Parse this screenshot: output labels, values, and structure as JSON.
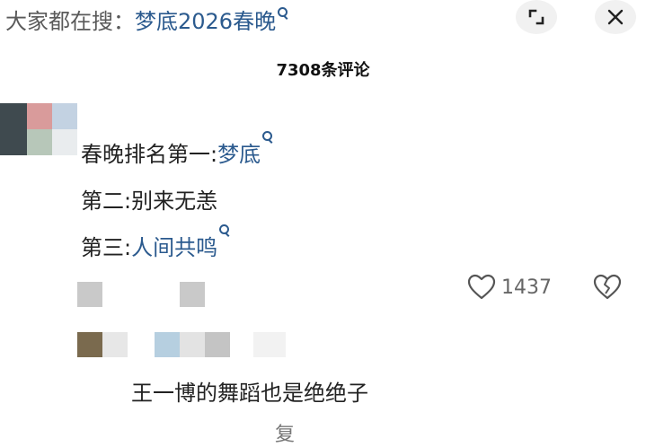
{
  "top_bar": {
    "prefix": "大家都在搜：",
    "search_term": "梦底2026春晚"
  },
  "header": {
    "comment_count": "7308条评论"
  },
  "comment": {
    "line1_prefix": "春晚排名第一:",
    "line1_link": "梦底",
    "line2": "第二:别来无恙",
    "line3_prefix": "第三:",
    "line3_link": "人间共鸣",
    "likes": "1437"
  },
  "reply": {
    "text": "王一博的舞蹈也是绝绝子",
    "action_label": "复"
  },
  "colors": {
    "link": "#2b5a8e",
    "text": "#222222",
    "muted": "#666666",
    "button_bg": "#f1f1f1"
  }
}
